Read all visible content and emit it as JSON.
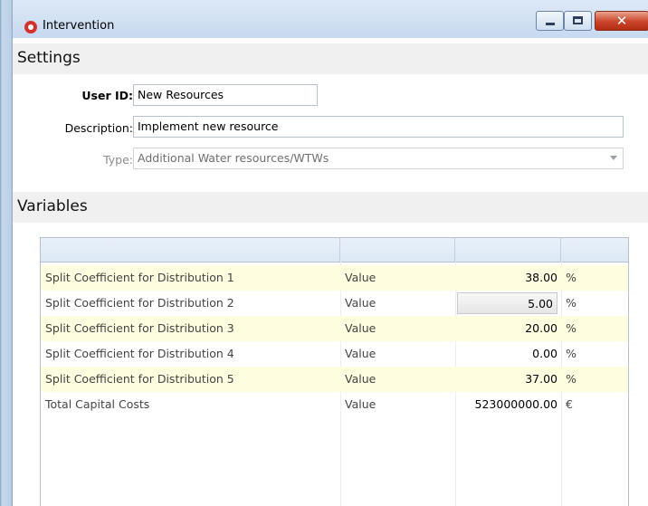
{
  "window": {
    "title": "Intervention"
  },
  "settings": {
    "title": "Settings",
    "user_id_label": "User ID:",
    "user_id_value": "New Resources",
    "description_label": "Description:",
    "description_value": "Implement new resource",
    "type_label": "Type:",
    "type_value": "Additional Water resources/WTWs"
  },
  "variables": {
    "title": "Variables",
    "rows": [
      {
        "name": "Split Coefficient for Distribution 1",
        "kind": "Value",
        "value": "38.00",
        "unit": "%"
      },
      {
        "name": "Split Coefficient for Distribution 2",
        "kind": "Value",
        "value": "5.00",
        "unit": "%"
      },
      {
        "name": "Split Coefficient for Distribution 3",
        "kind": "Value",
        "value": "20.00",
        "unit": "%"
      },
      {
        "name": "Split Coefficient for Distribution 4",
        "kind": "Value",
        "value": "0.00",
        "unit": "%"
      },
      {
        "name": "Split Coefficient for Distribution 5",
        "kind": "Value",
        "value": "37.00",
        "unit": "%"
      },
      {
        "name": "Total Capital Costs",
        "kind": "Value",
        "value": "523000000.00",
        "unit": "€"
      }
    ]
  },
  "colors": {
    "accent_row": "#fffde0",
    "section_bg": "#f0f0f0",
    "title_icon": "#d2322b"
  }
}
